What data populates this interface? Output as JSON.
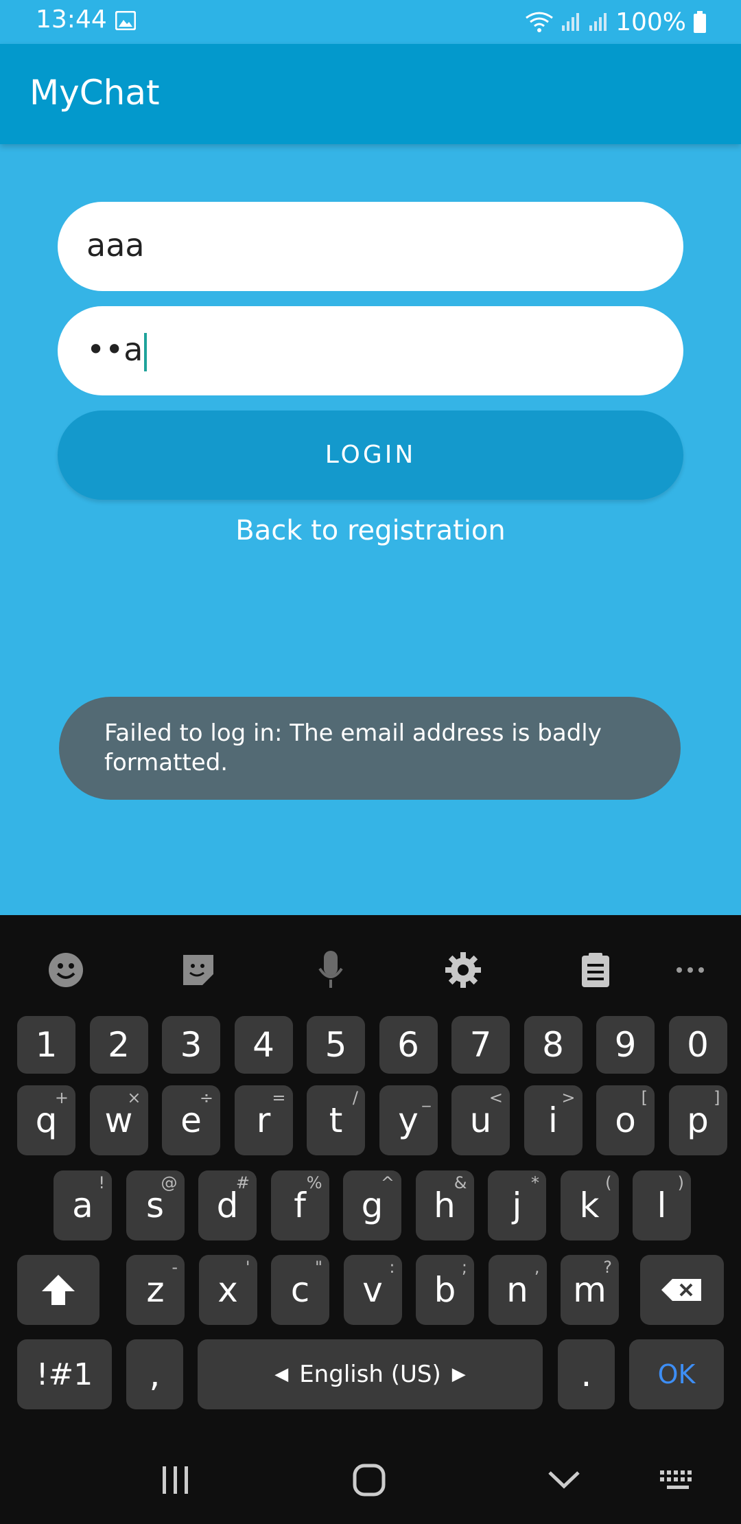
{
  "status": {
    "time": "13:44",
    "battery": "100%"
  },
  "app": {
    "title": "MyChat"
  },
  "form": {
    "email_value": "aaa",
    "password_value": "••a",
    "login_label": "LOGIN",
    "back_link": "Back to registration"
  },
  "toast": {
    "message": "Failed to log in: The email address is badly formatted."
  },
  "keyboard": {
    "toolbar": [
      "emoji-icon",
      "sticker-icon",
      "microphone-icon",
      "gear-icon",
      "clipboard-icon",
      "more-icon"
    ],
    "row_numbers": [
      "1",
      "2",
      "3",
      "4",
      "5",
      "6",
      "7",
      "8",
      "9",
      "0"
    ],
    "row1": [
      [
        "q",
        "+"
      ],
      [
        "w",
        "×"
      ],
      [
        "e",
        "÷"
      ],
      [
        "r",
        "="
      ],
      [
        "t",
        "/"
      ],
      [
        "y",
        "_"
      ],
      [
        "u",
        "<"
      ],
      [
        "i",
        ">"
      ],
      [
        "o",
        "["
      ],
      [
        "p",
        "]"
      ]
    ],
    "row2": [
      [
        "a",
        "!"
      ],
      [
        "s",
        "@"
      ],
      [
        "d",
        "#"
      ],
      [
        "f",
        "%"
      ],
      [
        "g",
        "^"
      ],
      [
        "h",
        "&"
      ],
      [
        "j",
        "*"
      ],
      [
        "k",
        "("
      ],
      [
        "l",
        ")"
      ]
    ],
    "row3": [
      [
        "z",
        "-"
      ],
      [
        "x",
        "'"
      ],
      [
        "c",
        "\""
      ],
      [
        "v",
        ":"
      ],
      [
        "b",
        ";"
      ],
      [
        "n",
        ","
      ],
      [
        "m",
        "?"
      ]
    ],
    "symbols_label": "!#1",
    "comma_label": ",",
    "space_label": "English (US)",
    "period_label": ".",
    "ok_label": "OK",
    "ok_color": "#3d8ef5"
  },
  "colors": {
    "background": "#35b4e6",
    "appbar": "#0399cc",
    "button": "#1499cc",
    "toast": "#536a74"
  }
}
